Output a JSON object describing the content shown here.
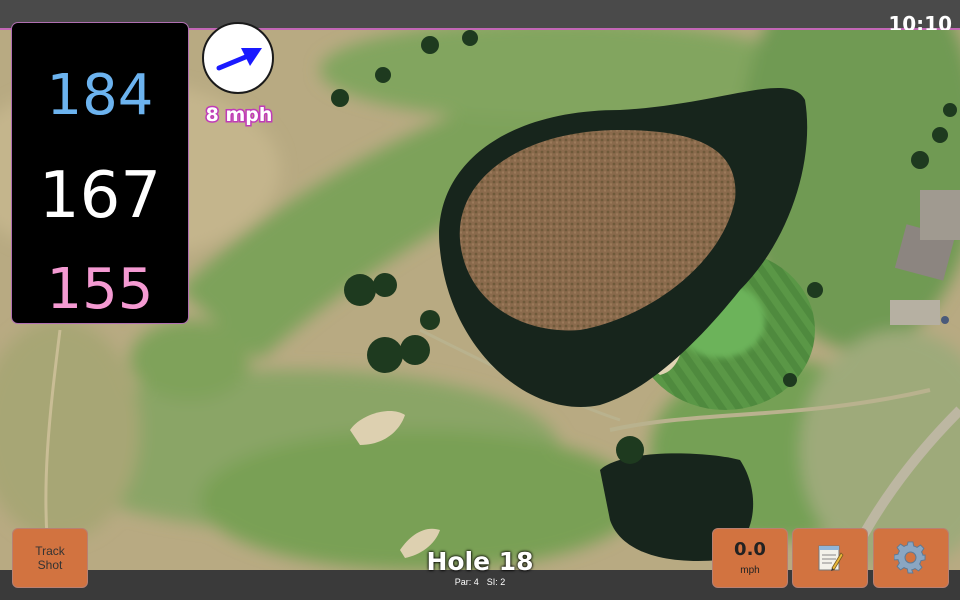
{
  "status": {
    "time": "10:10"
  },
  "distances": {
    "back": "184",
    "middle": "167",
    "front": "155"
  },
  "wind": {
    "speed": "8 mph",
    "icon": "arrow-icon",
    "arrow_color": "#1a1aff"
  },
  "buttons": {
    "track_shot": {
      "line1": "Track",
      "line2": "Shot"
    },
    "speed": {
      "value": "0.0",
      "unit": "mph"
    },
    "notes_icon": "notepad-icon",
    "settings_icon": "gear-icon"
  },
  "hole": {
    "title": "Hole 18",
    "par": "Par: 4",
    "si": "SI: 2"
  },
  "colors": {
    "accent": "#c267b6",
    "button": "#d27340",
    "back": "#6cb3ef",
    "front": "#f49ad2"
  }
}
